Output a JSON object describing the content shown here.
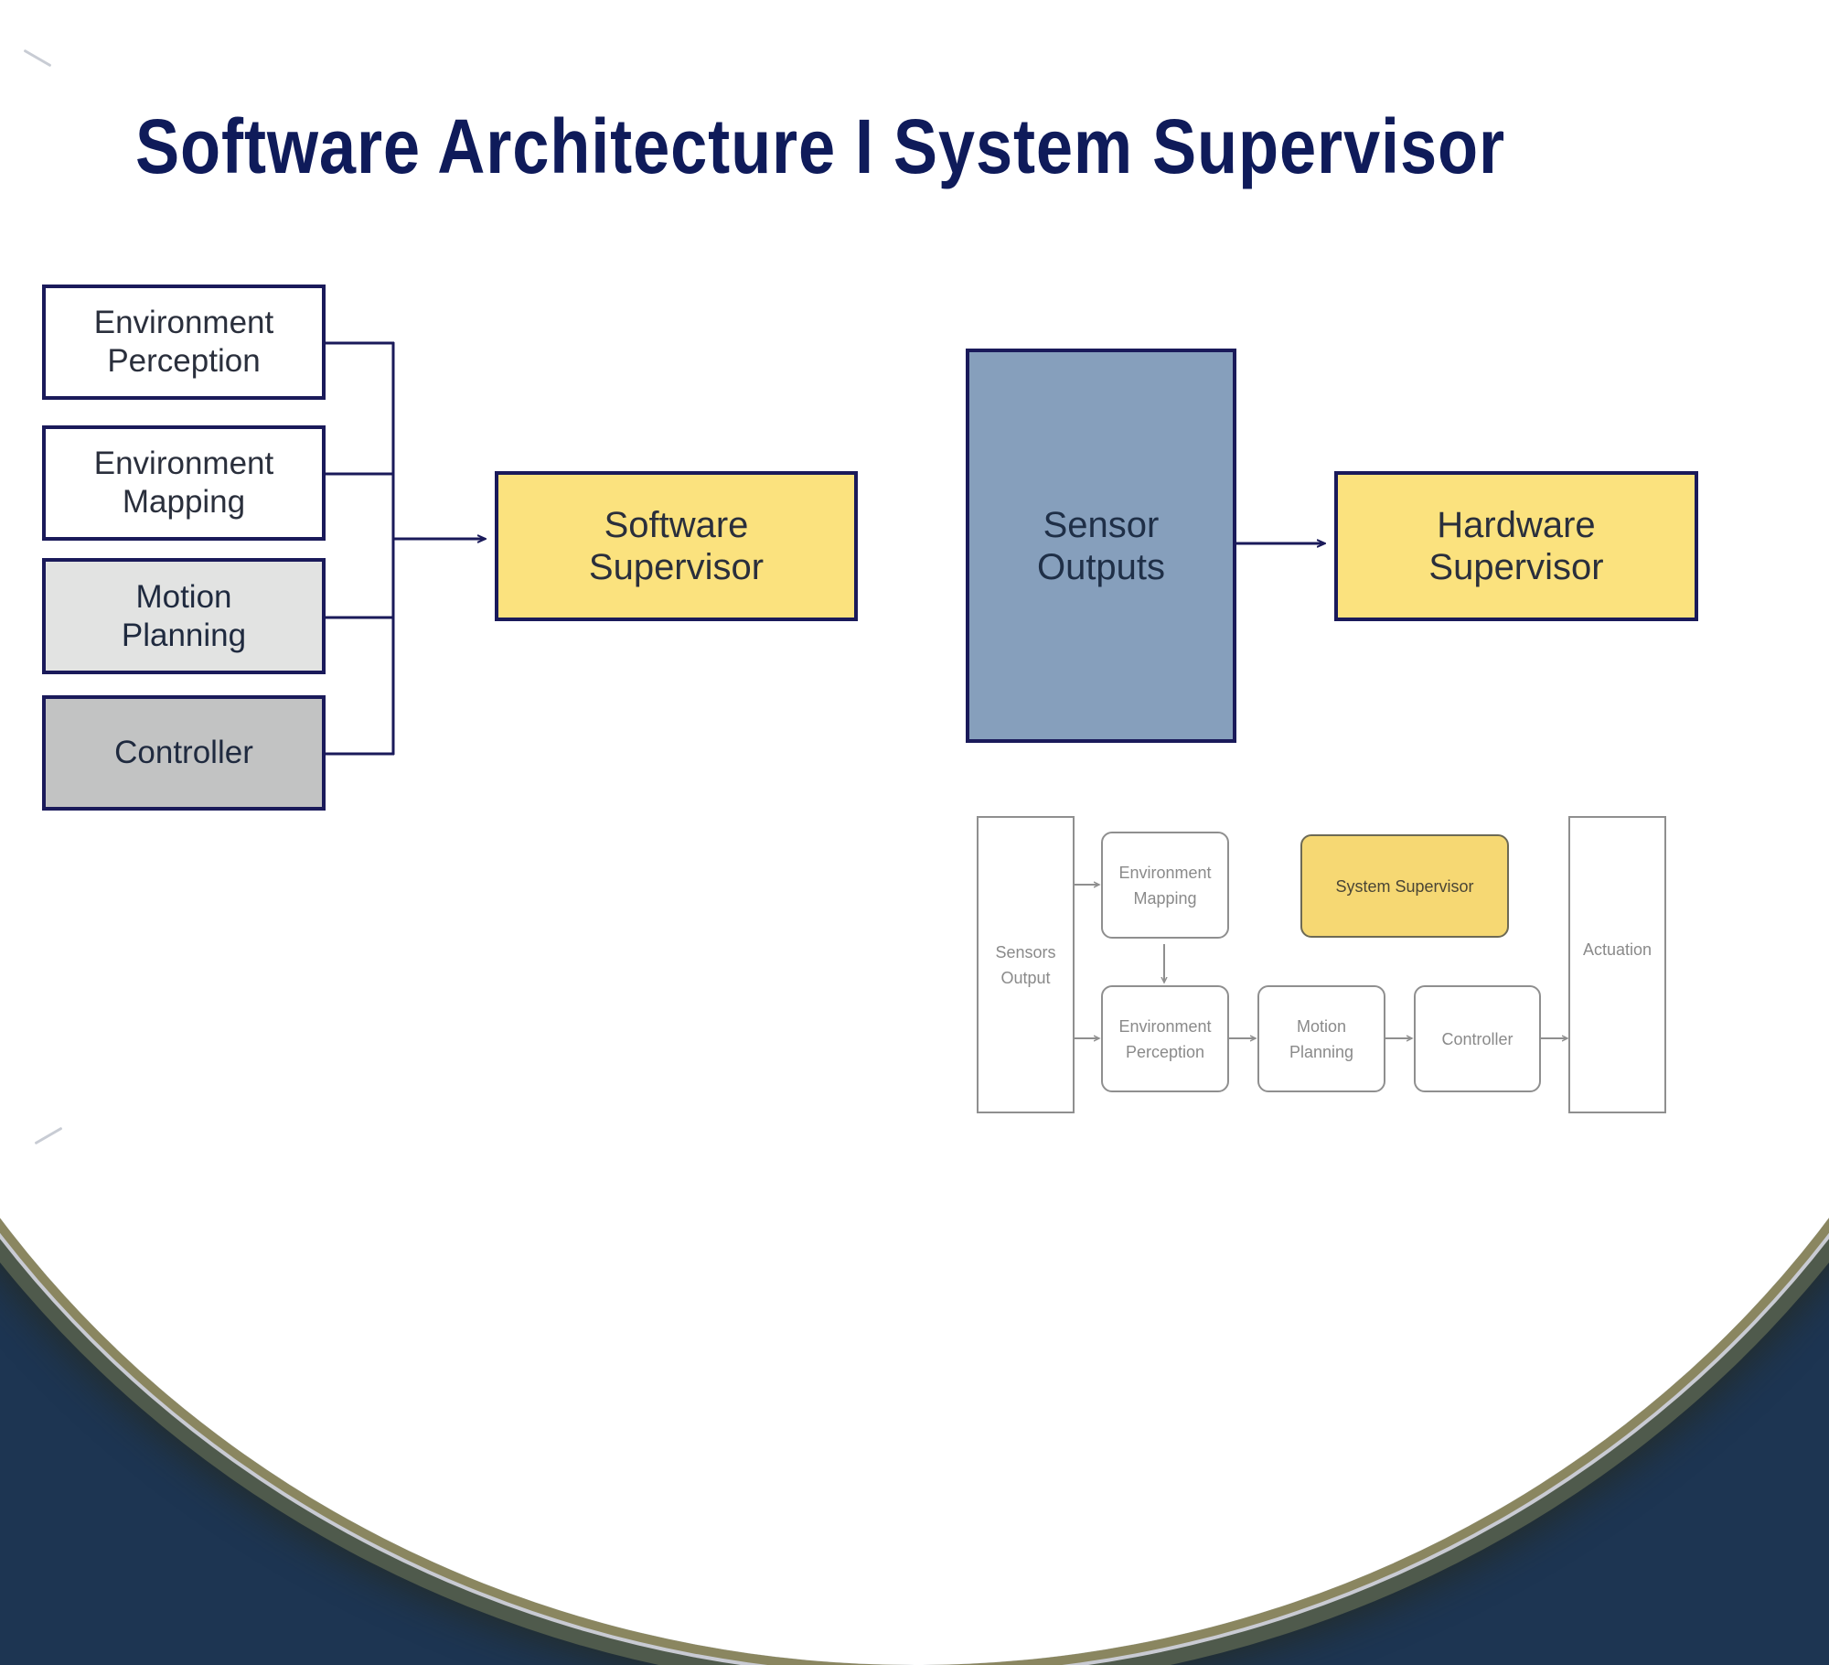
{
  "slide": {
    "title": "Software Architecture I System Supervisor"
  },
  "software_side": {
    "inputs": [
      {
        "label": "Environment\nPerception",
        "fill": "#ffffff"
      },
      {
        "label": "Environment\nMapping",
        "fill": "#ffffff"
      },
      {
        "label": "Motion\nPlanning",
        "fill": "#e2e3e2"
      },
      {
        "label": "Controller",
        "fill": "#c2c3c3"
      }
    ],
    "supervisor": {
      "label": "Software\nSupervisor",
      "fill": "#fbe27e"
    }
  },
  "hardware_side": {
    "source": {
      "label": "Sensor\nOutputs",
      "fill": "#869fbc"
    },
    "supervisor": {
      "label": "Hardware\nSupervisor",
      "fill": "#fbe27e"
    }
  },
  "overview_diagram": {
    "sensors_output": "Sensors\nOutput",
    "environment_mapping": "Environment\nMapping",
    "system_supervisor": "System Supervisor",
    "environment_perception": "Environment\nPerception",
    "motion_planning": "Motion\nPlanning",
    "controller": "Controller",
    "actuation": "Actuation"
  },
  "colors": {
    "title": "#0f1b5a",
    "border": "#1a1a5a",
    "supervisor_yellow": "#fbe27e",
    "sensor_blue": "#869fbc"
  }
}
